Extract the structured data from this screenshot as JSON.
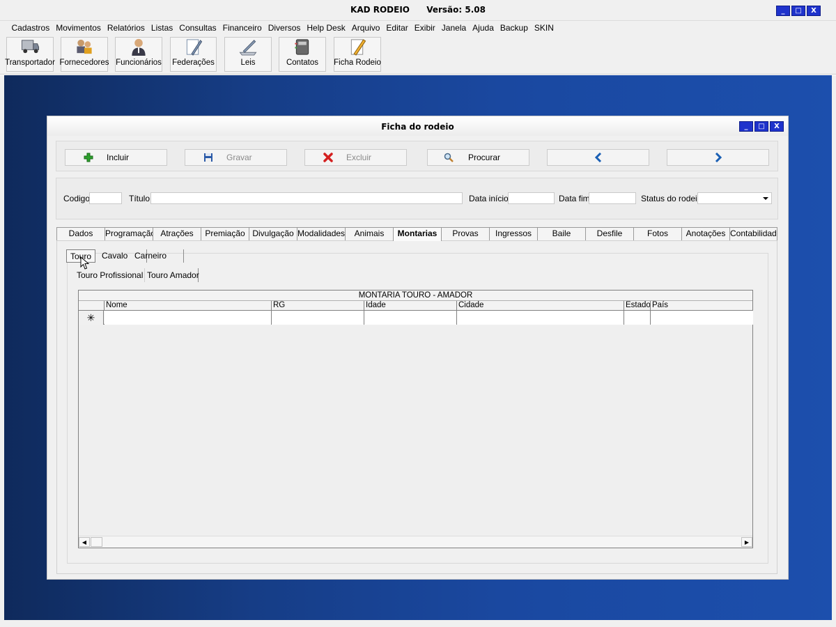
{
  "app": {
    "title": "KAD RODEIO",
    "version": "Versão: 5.08",
    "window_buttons": {
      "minimize": "_",
      "maximize": "□",
      "close": "X"
    }
  },
  "menu": [
    "Cadastros",
    "Movimentos",
    "Relatórios",
    "Listas",
    "Consultas",
    "Financeiro",
    "Diversos",
    "Help Desk",
    "Arquivo",
    "Editar",
    "Exibir",
    "Janela",
    "Ajuda",
    "Backup",
    "SKIN"
  ],
  "toolbar": [
    {
      "label": "Transportador",
      "icon": "truck-icon"
    },
    {
      "label": "Fornecedores",
      "icon": "suppliers-icon"
    },
    {
      "label": "Funcionários",
      "icon": "employee-icon"
    },
    {
      "label": "Federações",
      "icon": "document-pen-icon"
    },
    {
      "label": "Leis",
      "icon": "law-icon"
    },
    {
      "label": "Contatos",
      "icon": "contacts-book-icon"
    },
    {
      "label": "Ficha Rodeio",
      "icon": "note-pencil-icon"
    }
  ],
  "child_window": {
    "title": "Ficha do rodeio",
    "actions": {
      "incluir": "Incluir",
      "gravar": "Gravar",
      "excluir": "Excluir",
      "procurar": "Procurar"
    },
    "fields": {
      "codigo_label": "Codigo",
      "titulo_label": "Título",
      "data_inicio_label": "Data início",
      "data_fim_label": "Data fim",
      "status_label": "Status do rodeio",
      "codigo_value": "",
      "titulo_value": "",
      "data_inicio_value": "",
      "data_fim_value": "",
      "status_value": ""
    },
    "tabs": [
      "Dados",
      "Programação",
      "Atrações",
      "Premiação",
      "Divulgação",
      "Modalidades",
      "Animais",
      "Montarias",
      "Provas",
      "Ingressos",
      "Baile",
      "Desfile",
      "Fotos",
      "Anotações",
      "Contabilidade"
    ],
    "active_tab": "Montarias",
    "subtabs": [
      "Touro",
      "Cavalo",
      "Carneiro"
    ],
    "active_subtab": "Touro",
    "subsubtabs": [
      "Touro Profissional",
      "Touro Amador"
    ],
    "active_subsubtab": "Touro Amador",
    "grid": {
      "caption": "MONTARIA TOURO - AMADOR",
      "columns": [
        "Nome",
        "RG",
        "Idade",
        "Cidade",
        "Estado",
        "País"
      ],
      "new_row_marker": "✳"
    }
  },
  "colors": {
    "window_button": "#1f33cc",
    "desktop": "#1a48a0"
  }
}
